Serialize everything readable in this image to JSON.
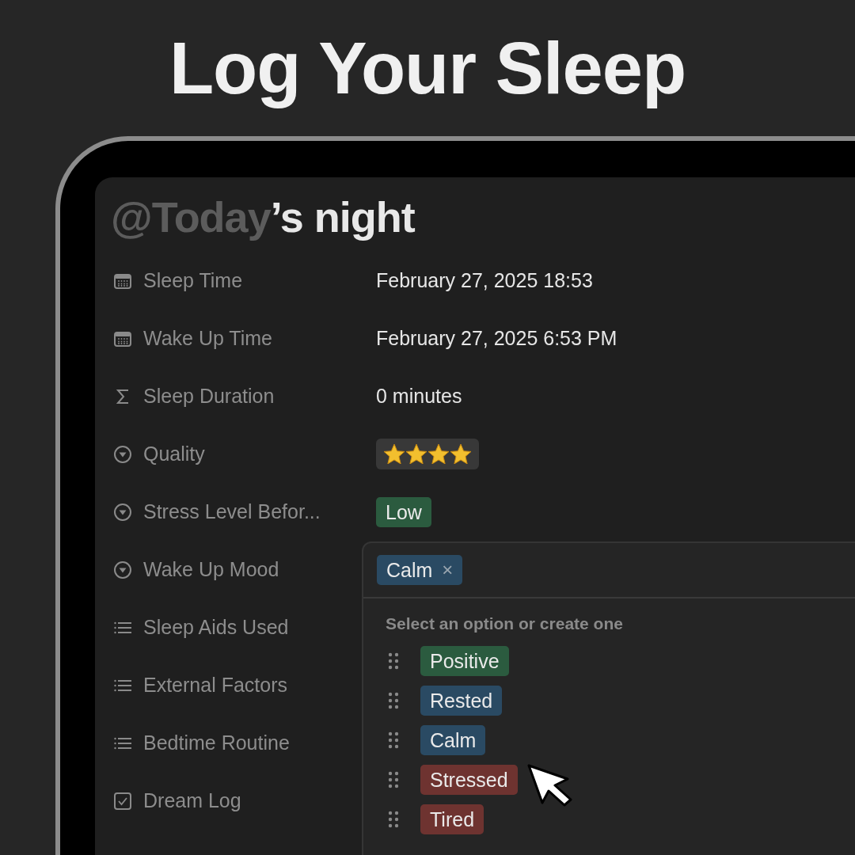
{
  "headline": "Log Your Sleep",
  "page_title": {
    "mention": "@Today",
    "text": "’s night"
  },
  "properties": [
    {
      "kind": "date",
      "label": "Sleep Time",
      "value": {
        "kind": "text",
        "text": "February 27, 2025 18:53"
      }
    },
    {
      "kind": "date",
      "label": "Wake Up Time",
      "value": {
        "kind": "text",
        "text": "February 27, 2025 6:53 PM"
      }
    },
    {
      "kind": "formula",
      "label": "Sleep Duration",
      "value": {
        "kind": "text",
        "text": "0 minutes"
      }
    },
    {
      "kind": "select",
      "label": "Quality",
      "value": {
        "kind": "stars",
        "stars": 4
      }
    },
    {
      "kind": "select",
      "label": "Stress Level Befor...",
      "value": {
        "kind": "tag",
        "text": "Low",
        "color": "#2b5b3f"
      }
    },
    {
      "kind": "select",
      "label": "Wake Up Mood"
    },
    {
      "kind": "multi_select",
      "label": "Sleep Aids Used"
    },
    {
      "kind": "multi_select",
      "label": "External Factors"
    },
    {
      "kind": "multi_select",
      "label": "Bedtime Routine"
    },
    {
      "kind": "checkbox",
      "label": "Dream Log"
    }
  ],
  "dropdown": {
    "selected_tags": [
      {
        "text": "Calm",
        "color": "#2a4a63",
        "remove": "×"
      }
    ],
    "hint": "Select an option or create one",
    "options": [
      {
        "text": "Positive",
        "color": "#2b5b3f"
      },
      {
        "text": "Rested",
        "color": "#2a4a63"
      },
      {
        "text": "Calm",
        "color": "#2a4a63"
      },
      {
        "text": "Stressed",
        "color": "#6e3330"
      },
      {
        "text": "Tired",
        "color": "#6e3330"
      }
    ]
  }
}
